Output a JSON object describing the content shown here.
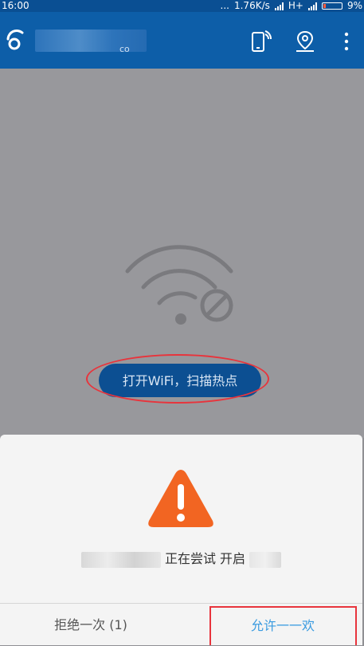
{
  "status": {
    "time": "16:00",
    "dots": "...",
    "speed": "1.76K/s",
    "network": "H+",
    "battery": "9%"
  },
  "appbar": {
    "subtitle": "co",
    "icons": [
      "phone-wifi-icon",
      "location-pin-icon",
      "more-vert-icon"
    ]
  },
  "main": {
    "illustration": "wifi-off-icon",
    "open_wifi_button": "打开WiFi，扫描热点"
  },
  "dialog": {
    "icon": "warning-icon",
    "message_part1": "正在尝试 开启",
    "deny_label": "拒绝一次 (1)",
    "allow_label": "允许一一欢"
  },
  "colors": {
    "appbar": "#0d5ea8",
    "button": "#0c4f92",
    "warning": "#f26522",
    "annotation": "#e8343c",
    "allow_text": "#3a9be0"
  }
}
